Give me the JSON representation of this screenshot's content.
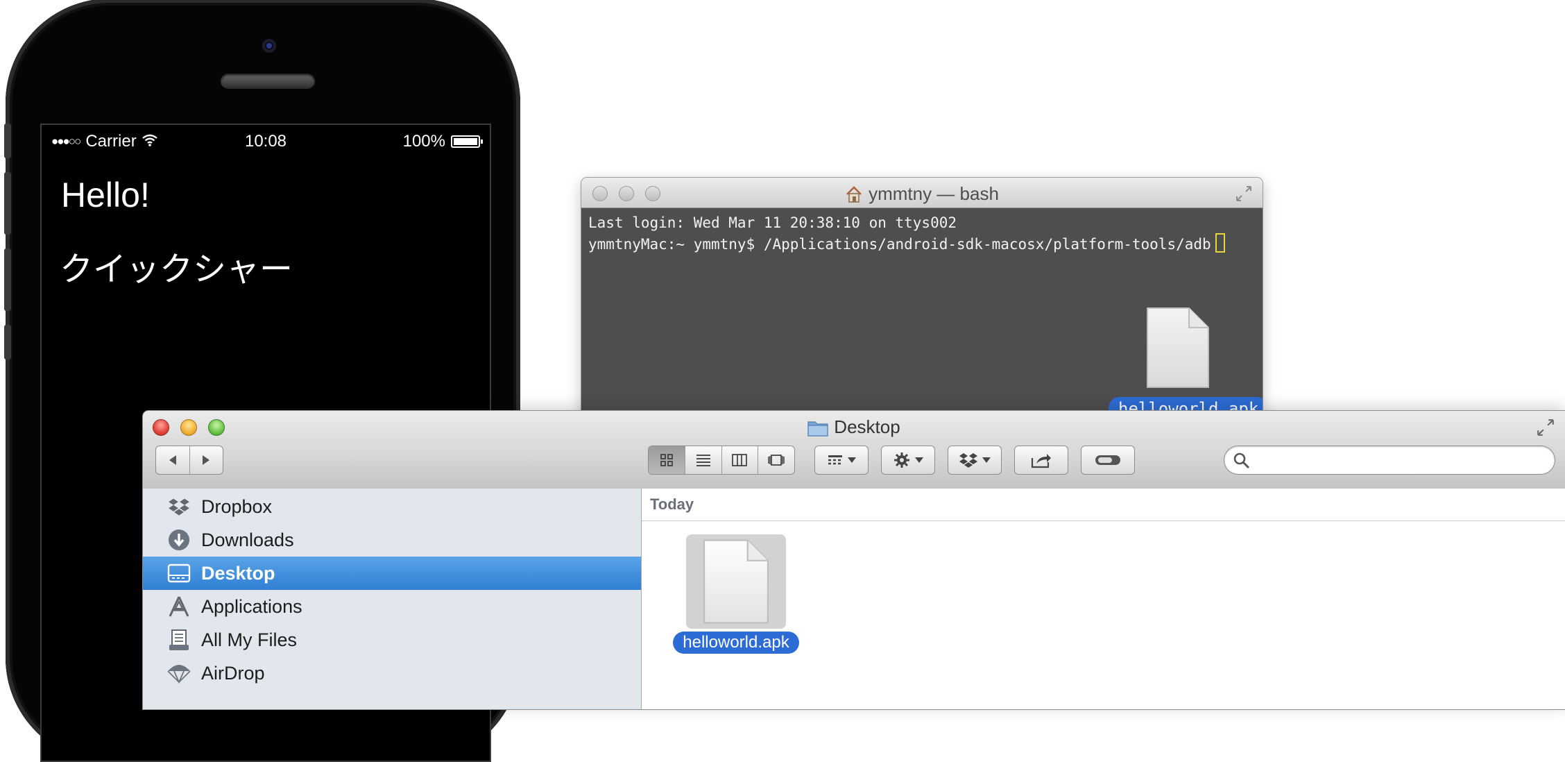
{
  "phone": {
    "status": {
      "signal": "●●●○○",
      "carrier": "Carrier",
      "time": "10:08",
      "battery": "100%"
    },
    "labels": {
      "hello": "Hello!",
      "japanese": "クイックシャー"
    }
  },
  "terminal": {
    "title": "ymmtny — bash",
    "lines": {
      "last_login": "Last login: Wed Mar 11 20:38:10 on ttys002",
      "prompt": "ymmtnyMac:~ ymmtny$ /Applications/android-sdk-macosx/platform-tools/adb"
    },
    "dragged_file": "helloworld.apk"
  },
  "finder": {
    "title": "Desktop",
    "search": {
      "placeholder": ""
    },
    "sidebar": {
      "items": [
        {
          "label": "Dropbox",
          "icon": "dropbox-icon"
        },
        {
          "label": "Downloads",
          "icon": "downloads-icon"
        },
        {
          "label": "Desktop",
          "icon": "desktop-icon",
          "selected": true
        },
        {
          "label": "Applications",
          "icon": "applications-icon"
        },
        {
          "label": "All My Files",
          "icon": "all-my-files-icon"
        },
        {
          "label": "AirDrop",
          "icon": "airdrop-icon"
        }
      ]
    },
    "content": {
      "section": "Today",
      "file": "helloworld.apk"
    }
  },
  "colors": {
    "selection_blue": "#2d6cd4",
    "sidebar_bg": "#e2e7ed",
    "terminal_bg": "#4e4e4e"
  }
}
